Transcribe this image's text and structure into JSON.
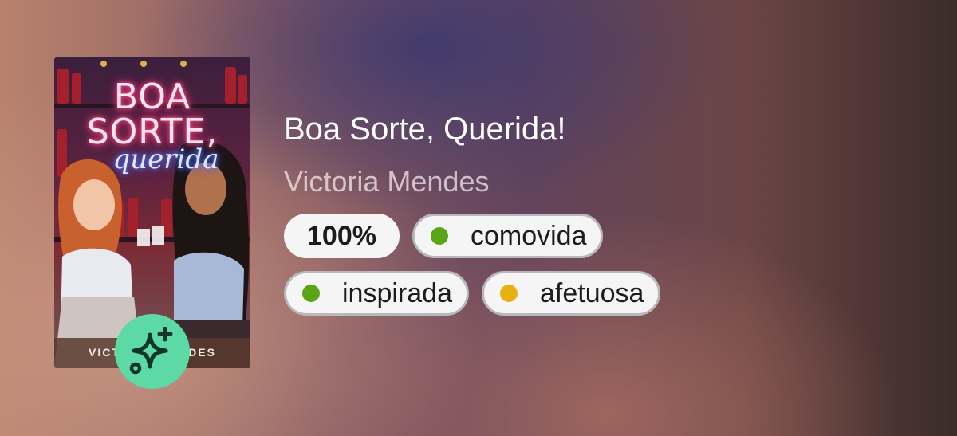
{
  "book": {
    "title": "Boa Sorte, Querida!",
    "author": "Victoria Mendes",
    "cover": {
      "title_text": "BOA\nSORTE,",
      "script_text": "querida",
      "author_text": "VICTORIA MENDES"
    }
  },
  "progress_label": "100%",
  "moods": [
    {
      "label": "comovida",
      "color": "#5aa516"
    },
    {
      "label": "inspirada",
      "color": "#5aa516"
    },
    {
      "label": "afetuosa",
      "color": "#e6b10f"
    }
  ],
  "badge": {
    "icon": "sparkle-add-icon",
    "color": "#5cd9a5"
  }
}
